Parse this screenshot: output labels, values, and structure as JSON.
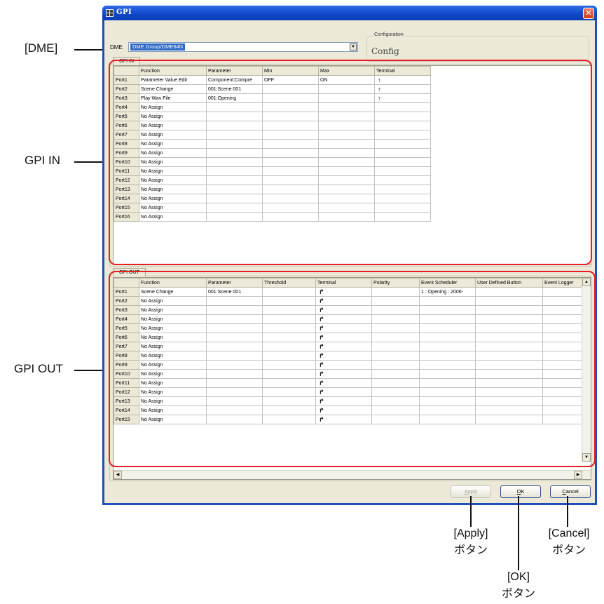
{
  "window": {
    "title": "GPI",
    "close_symbol": "✕"
  },
  "dme": {
    "label": "DME",
    "selected": "DME Group/DME64N",
    "config_label": "Configuration",
    "config_value": "Config"
  },
  "gpi_in": {
    "tab": "GPI IN",
    "columns": [
      "",
      "Function",
      "Parameter",
      "Min",
      "Max",
      "Terminal"
    ],
    "rows": [
      [
        "Port1",
        "Parameter Value Edit",
        "Component:Compre",
        "OFF",
        "ON",
        "↑"
      ],
      [
        "Port2",
        "Scene Change",
        "001:Scene 001",
        "",
        "",
        "↑"
      ],
      [
        "Port3",
        "Play Wav File",
        "001:Opening",
        "",
        "",
        "↑"
      ],
      [
        "Port4",
        "No Assign",
        "",
        "",
        "",
        ""
      ],
      [
        "Port5",
        "No Assign",
        "",
        "",
        "",
        ""
      ],
      [
        "Port6",
        "No Assign",
        "",
        "",
        "",
        ""
      ],
      [
        "Port7",
        "No Assign",
        "",
        "",
        "",
        ""
      ],
      [
        "Port8",
        "No Assign",
        "",
        "",
        "",
        ""
      ],
      [
        "Port9",
        "No Assign",
        "",
        "",
        "",
        ""
      ],
      [
        "Port10",
        "No Assign",
        "",
        "",
        "",
        ""
      ],
      [
        "Port11",
        "No Assign",
        "",
        "",
        "",
        ""
      ],
      [
        "Port12",
        "No Assign",
        "",
        "",
        "",
        ""
      ],
      [
        "Port13",
        "No Assign",
        "",
        "",
        "",
        ""
      ],
      [
        "Port14",
        "No Assign",
        "",
        "",
        "",
        ""
      ],
      [
        "Port15",
        "No Assign",
        "",
        "",
        "",
        ""
      ],
      [
        "Port16",
        "No Assign",
        "",
        "",
        "",
        ""
      ]
    ]
  },
  "gpi_out": {
    "tab": "GPI OUT",
    "columns": [
      "",
      "Function",
      "Parameter",
      "Threshold",
      "Terminal",
      "Polarity",
      "Event Scheduler",
      "User Defined Button",
      "Event Logger"
    ],
    "rows": [
      [
        "Port1",
        "Scene Change",
        "001:Scene 001",
        "",
        "↱",
        "",
        "1 : Opening : 2006-",
        "",
        ""
      ],
      [
        "Port2",
        "No Assign",
        "",
        "",
        "↱",
        "",
        "",
        "",
        ""
      ],
      [
        "Port3",
        "No Assign",
        "",
        "",
        "↱",
        "",
        "",
        "",
        ""
      ],
      [
        "Port4",
        "No Assign",
        "",
        "",
        "↱",
        "",
        "",
        "",
        ""
      ],
      [
        "Port5",
        "No Assign",
        "",
        "",
        "↱",
        "",
        "",
        "",
        ""
      ],
      [
        "Port6",
        "No Assign",
        "",
        "",
        "↱",
        "",
        "",
        "",
        ""
      ],
      [
        "Port7",
        "No Assign",
        "",
        "",
        "↱",
        "",
        "",
        "",
        ""
      ],
      [
        "Port8",
        "No Assign",
        "",
        "",
        "↱",
        "",
        "",
        "",
        ""
      ],
      [
        "Port9",
        "No Assign",
        "",
        "",
        "↱",
        "",
        "",
        "",
        ""
      ],
      [
        "Port10",
        "No Assign",
        "",
        "",
        "↱",
        "",
        "",
        "",
        ""
      ],
      [
        "Port11",
        "No Assign",
        "",
        "",
        "↱",
        "",
        "",
        "",
        ""
      ],
      [
        "Port12",
        "No Assign",
        "",
        "",
        "↱",
        "",
        "",
        "",
        ""
      ],
      [
        "Port13",
        "No Assign",
        "",
        "",
        "↱",
        "",
        "",
        "",
        ""
      ],
      [
        "Port14",
        "No Assign",
        "",
        "",
        "↱",
        "",
        "",
        "",
        ""
      ],
      [
        "Port15",
        "No Assign",
        "",
        "",
        "↱",
        "",
        "",
        "",
        ""
      ]
    ]
  },
  "buttons": {
    "apply": {
      "pre": "",
      "mn": "A",
      "post": "pply"
    },
    "ok": {
      "pre": "",
      "mn": "O",
      "post": "K"
    },
    "cancel": {
      "pre": "",
      "mn": "C",
      "post": "ancel"
    }
  },
  "callouts": {
    "dme": "[DME]",
    "gpi_in": "GPI IN",
    "gpi_out": "GPI OUT",
    "apply_line1": "[Apply]",
    "apply_line2": "ボタン",
    "ok_line1": "[OK]",
    "ok_line2": "ボタン",
    "cancel_line1": "[Cancel]",
    "cancel_line2": "ボタン"
  },
  "colors": {
    "titlebar": "#0f46c8",
    "dialog_bg": "#ece9d8",
    "highlight_frame": "#e31e24",
    "selection": "#316ac5"
  }
}
